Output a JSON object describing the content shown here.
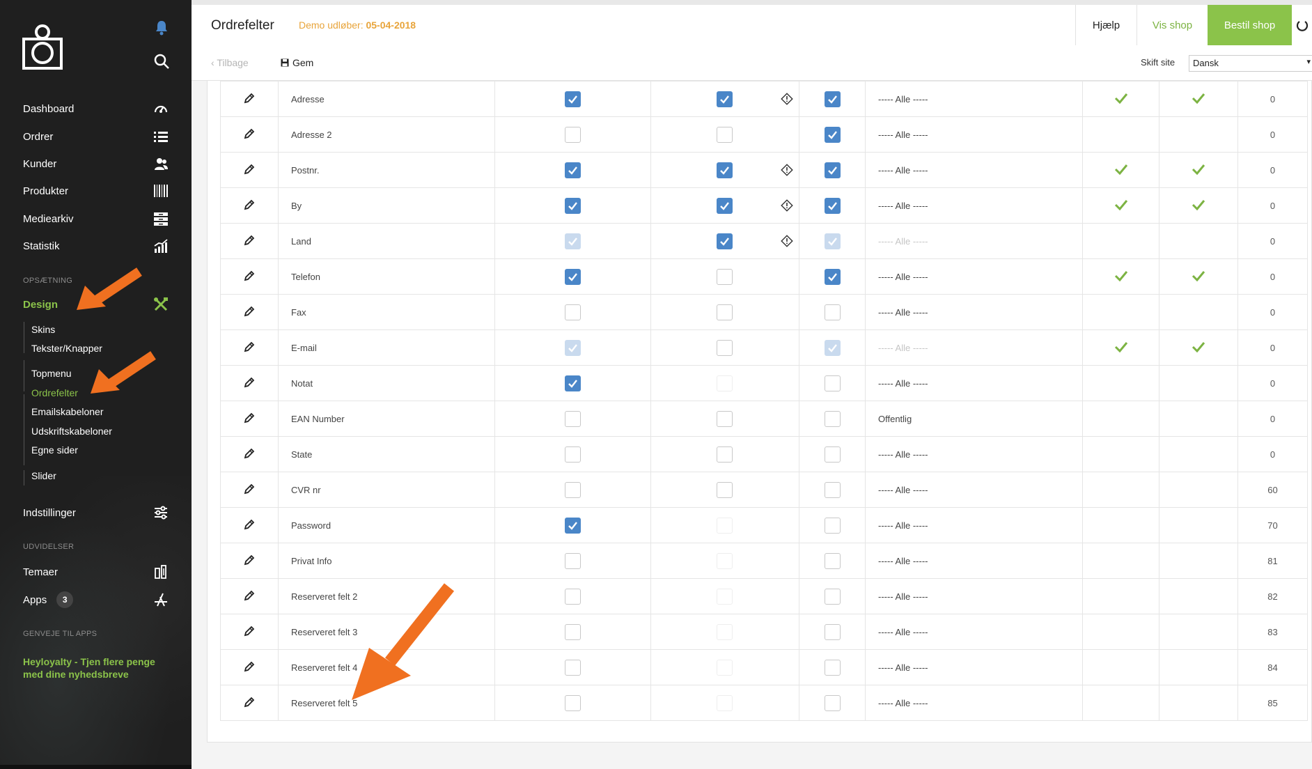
{
  "sidebar": {
    "nav": [
      {
        "label": "Dashboard",
        "icon": "speedometer-icon"
      },
      {
        "label": "Ordrer",
        "icon": "list-icon"
      },
      {
        "label": "Kunder",
        "icon": "users-icon"
      },
      {
        "label": "Produkter",
        "icon": "barcode-icon"
      },
      {
        "label": "Mediearkiv",
        "icon": "archive-icon"
      },
      {
        "label": "Statistik",
        "icon": "chart-icon"
      }
    ],
    "setup_label": "OPSÆTNING",
    "design": {
      "label": "Design",
      "icon": "tools-icon"
    },
    "design_sub": [
      "Skins",
      "Tekster/Knapper",
      "Topmenu",
      "Ordrefelter",
      "Emailskabeloner",
      "Udskriftskabeloner",
      "Egne sider",
      "Slider"
    ],
    "settings": {
      "label": "Indstillinger",
      "icon": "sliders-icon"
    },
    "extensions_label": "UDVIDELSER",
    "themes": {
      "label": "Temaer",
      "icon": "themes-icon"
    },
    "apps": {
      "label": "Apps",
      "badge": "3",
      "icon": "appstore-icon"
    },
    "shortcuts_label": "GENVEJE TIL APPS",
    "promo": "Heyloyalty - Tjen flere penge med dine nyhedsbreve"
  },
  "header": {
    "title": "Ordrefelter",
    "demo_label": "Demo udløber:",
    "demo_date": "05-04-2018",
    "help": "Hjælp",
    "view_shop": "Vis shop",
    "order_shop": "Bestil shop",
    "back": "Tilbage",
    "save": "Gem",
    "site_label": "Skift site",
    "site_value": "Dansk"
  },
  "colors": {
    "accent_green": "#8bc34a",
    "check_blue": "#4a86c8",
    "arrow_orange": "#f07020",
    "demo_orange": "#e8a43a"
  },
  "rows": [
    {
      "name": "Adresse",
      "a": "checked",
      "b": "checked",
      "warn": true,
      "c": "checked",
      "vis": "----- Alle -----",
      "d": true,
      "e": true,
      "num": "0"
    },
    {
      "name": "Adresse 2",
      "a": "empty",
      "b": "empty",
      "warn": false,
      "c": "checked",
      "vis": "----- Alle -----",
      "d": false,
      "e": false,
      "num": "0"
    },
    {
      "name": "Postnr.",
      "a": "checked",
      "b": "checked",
      "warn": true,
      "c": "checked",
      "vis": "----- Alle -----",
      "d": true,
      "e": true,
      "num": "0"
    },
    {
      "name": "By",
      "a": "checked",
      "b": "checked",
      "warn": true,
      "c": "checked",
      "vis": "----- Alle -----",
      "d": true,
      "e": true,
      "num": "0"
    },
    {
      "name": "Land",
      "a": "dim",
      "b": "checked",
      "warn": true,
      "c": "dim",
      "vis": "----- Alle -----",
      "visdim": true,
      "d": false,
      "e": false,
      "num": "0"
    },
    {
      "name": "Telefon",
      "a": "checked",
      "b": "empty",
      "warn": false,
      "c": "checked",
      "vis": "----- Alle -----",
      "d": true,
      "e": true,
      "num": "0"
    },
    {
      "name": "Fax",
      "a": "empty",
      "b": "empty",
      "warn": false,
      "c": "empty",
      "vis": "----- Alle -----",
      "d": false,
      "e": false,
      "num": "0"
    },
    {
      "name": "E-mail",
      "a": "dim",
      "b": "empty",
      "warn": false,
      "c": "dim",
      "vis": "----- Alle -----",
      "visdim": true,
      "d": true,
      "e": true,
      "num": "0"
    },
    {
      "name": "Notat",
      "a": "checked",
      "b": "ghost",
      "warn": false,
      "c": "empty",
      "vis": "----- Alle -----",
      "d": false,
      "e": false,
      "num": "0"
    },
    {
      "name": "EAN Number",
      "a": "empty",
      "b": "empty",
      "warn": false,
      "c": "empty",
      "vis": "Offentlig",
      "d": false,
      "e": false,
      "num": "0"
    },
    {
      "name": "State",
      "a": "empty",
      "b": "empty",
      "warn": false,
      "c": "empty",
      "vis": "----- Alle -----",
      "d": false,
      "e": false,
      "num": "0"
    },
    {
      "name": "CVR nr",
      "a": "empty",
      "b": "empty",
      "warn": false,
      "c": "empty",
      "vis": "----- Alle -----",
      "d": false,
      "e": false,
      "num": "60"
    },
    {
      "name": "Password",
      "a": "checked",
      "b": "ghost",
      "warn": false,
      "c": "empty",
      "vis": "----- Alle -----",
      "d": false,
      "e": false,
      "num": "70"
    },
    {
      "name": "Privat Info",
      "a": "empty",
      "b": "ghost",
      "warn": false,
      "c": "empty",
      "vis": "----- Alle -----",
      "d": false,
      "e": false,
      "num": "81"
    },
    {
      "name": "Reserveret felt 2",
      "a": "empty",
      "b": "ghost",
      "warn": false,
      "c": "empty",
      "vis": "----- Alle -----",
      "d": false,
      "e": false,
      "num": "82"
    },
    {
      "name": "Reserveret felt 3",
      "a": "empty",
      "b": "ghost",
      "warn": false,
      "c": "empty",
      "vis": "----- Alle -----",
      "d": false,
      "e": false,
      "num": "83"
    },
    {
      "name": "Reserveret felt 4",
      "a": "empty",
      "b": "ghost",
      "warn": false,
      "c": "empty",
      "vis": "----- Alle -----",
      "d": false,
      "e": false,
      "num": "84"
    },
    {
      "name": "Reserveret felt 5",
      "a": "empty",
      "b": "ghost",
      "warn": false,
      "c": "empty",
      "vis": "----- Alle -----",
      "d": false,
      "e": false,
      "num": "85"
    }
  ]
}
